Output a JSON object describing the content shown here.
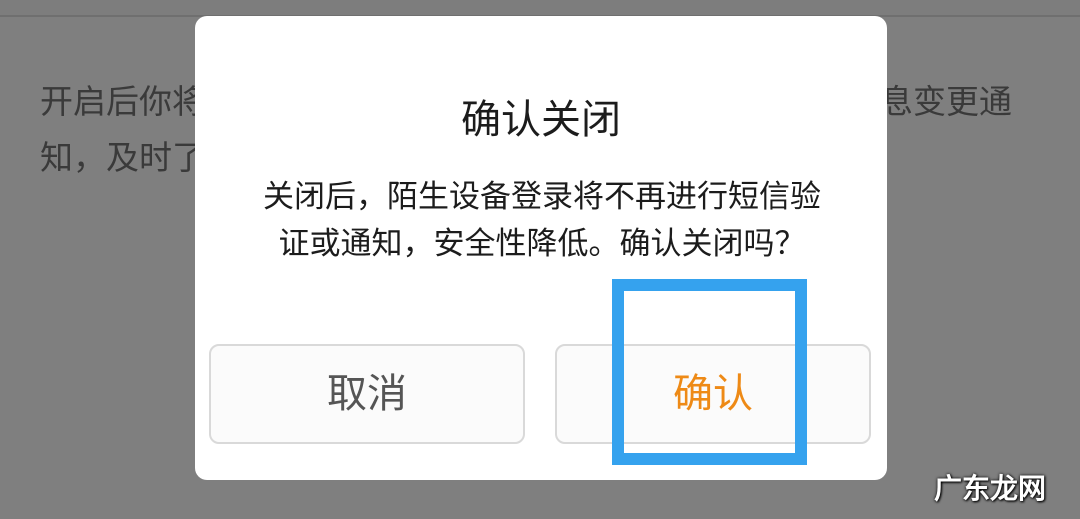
{
  "background": {
    "left_text": [
      "开启后你将",
      "知，及时了"
    ],
    "right_text": [
      "息变更通"
    ]
  },
  "dialog": {
    "title": "确认关闭",
    "message": "关闭后，陌生设备登录将不再进行短信验证或通知，安全性降低。确认关闭吗？",
    "cancel_label": "取消",
    "confirm_label": "确认"
  },
  "watermark": "广东龙网",
  "colors": {
    "confirm_text": "#ee8a16",
    "highlight_border": "#35a2ee",
    "overlay": "#7f7f7f"
  }
}
